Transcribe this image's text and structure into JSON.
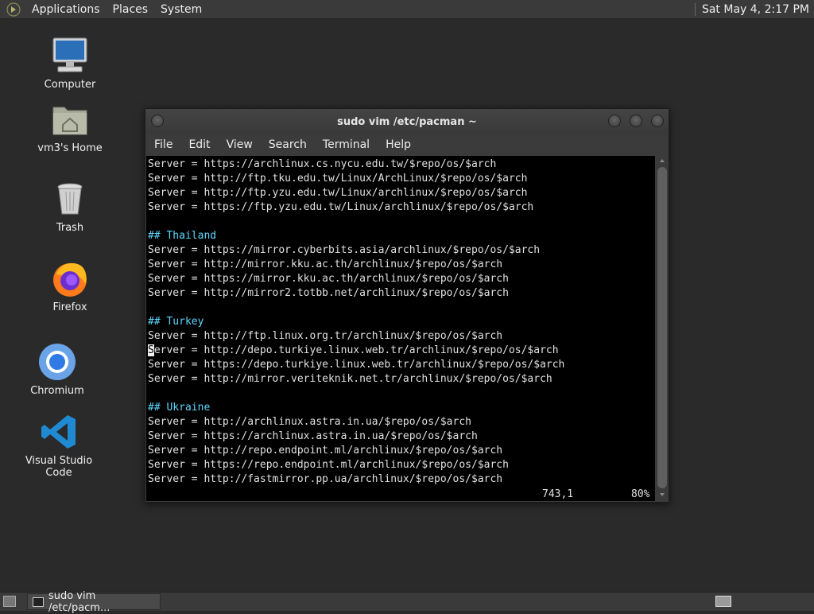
{
  "top_panel": {
    "menus": [
      "Applications",
      "Places",
      "System"
    ],
    "clock": "Sat May  4,  2:17 PM"
  },
  "desktop_icons": [
    {
      "label": "Computer",
      "icon": "computer-icon"
    },
    {
      "label": "vm3's Home",
      "icon": "home-folder-icon"
    },
    {
      "label": "Trash",
      "icon": "trash-icon"
    },
    {
      "label": "Firefox",
      "icon": "firefox-icon"
    },
    {
      "label": "Chromium",
      "icon": "chromium-icon"
    },
    {
      "label": "Visual Studio Code",
      "icon": "vscode-icon"
    }
  ],
  "window": {
    "title": "sudo vim /etc/pacman ~",
    "menu": [
      "File",
      "Edit",
      "View",
      "Search",
      "Terminal",
      "Help"
    ]
  },
  "terminal": {
    "lines": [
      "Server = https://archlinux.cs.nycu.edu.tw/$repo/os/$arch",
      "Server = http://ftp.tku.edu.tw/Linux/ArchLinux/$repo/os/$arch",
      "Server = http://ftp.yzu.edu.tw/Linux/archlinux/$repo/os/$arch",
      "Server = https://ftp.yzu.edu.tw/Linux/archlinux/$repo/os/$arch",
      "",
      "## Thailand",
      "Server = https://mirror.cyberbits.asia/archlinux/$repo/os/$arch",
      "Server = http://mirror.kku.ac.th/archlinux/$repo/os/$arch",
      "Server = https://mirror.kku.ac.th/archlinux/$repo/os/$arch",
      "Server = http://mirror2.totbb.net/archlinux/$repo/os/$arch",
      "",
      "## Turkey",
      "Server = http://ftp.linux.org.tr/archlinux/$repo/os/$arch",
      "Server = http://depo.turkiye.linux.web.tr/archlinux/$repo/os/$arch",
      "Server = https://depo.turkiye.linux.web.tr/archlinux/$repo/os/$arch",
      "Server = http://mirror.veriteknik.net.tr/archlinux/$repo/os/$arch",
      "",
      "## Ukraine",
      "Server = http://archlinux.astra.in.ua/$repo/os/$arch",
      "Server = https://archlinux.astra.in.ua/$repo/os/$arch",
      "Server = http://repo.endpoint.ml/archlinux/$repo/os/$arch",
      "Server = https://repo.endpoint.ml/archlinux/$repo/os/$arch",
      "Server = http://fastmirror.pp.ua/archlinux/$repo/os/$arch"
    ],
    "cursor_line": 13,
    "position": "743,1",
    "percent": "80%",
    "comment_color": "#5fd7ff"
  },
  "taskbar": {
    "task_label": "sudo vim /etc/pacm..."
  }
}
